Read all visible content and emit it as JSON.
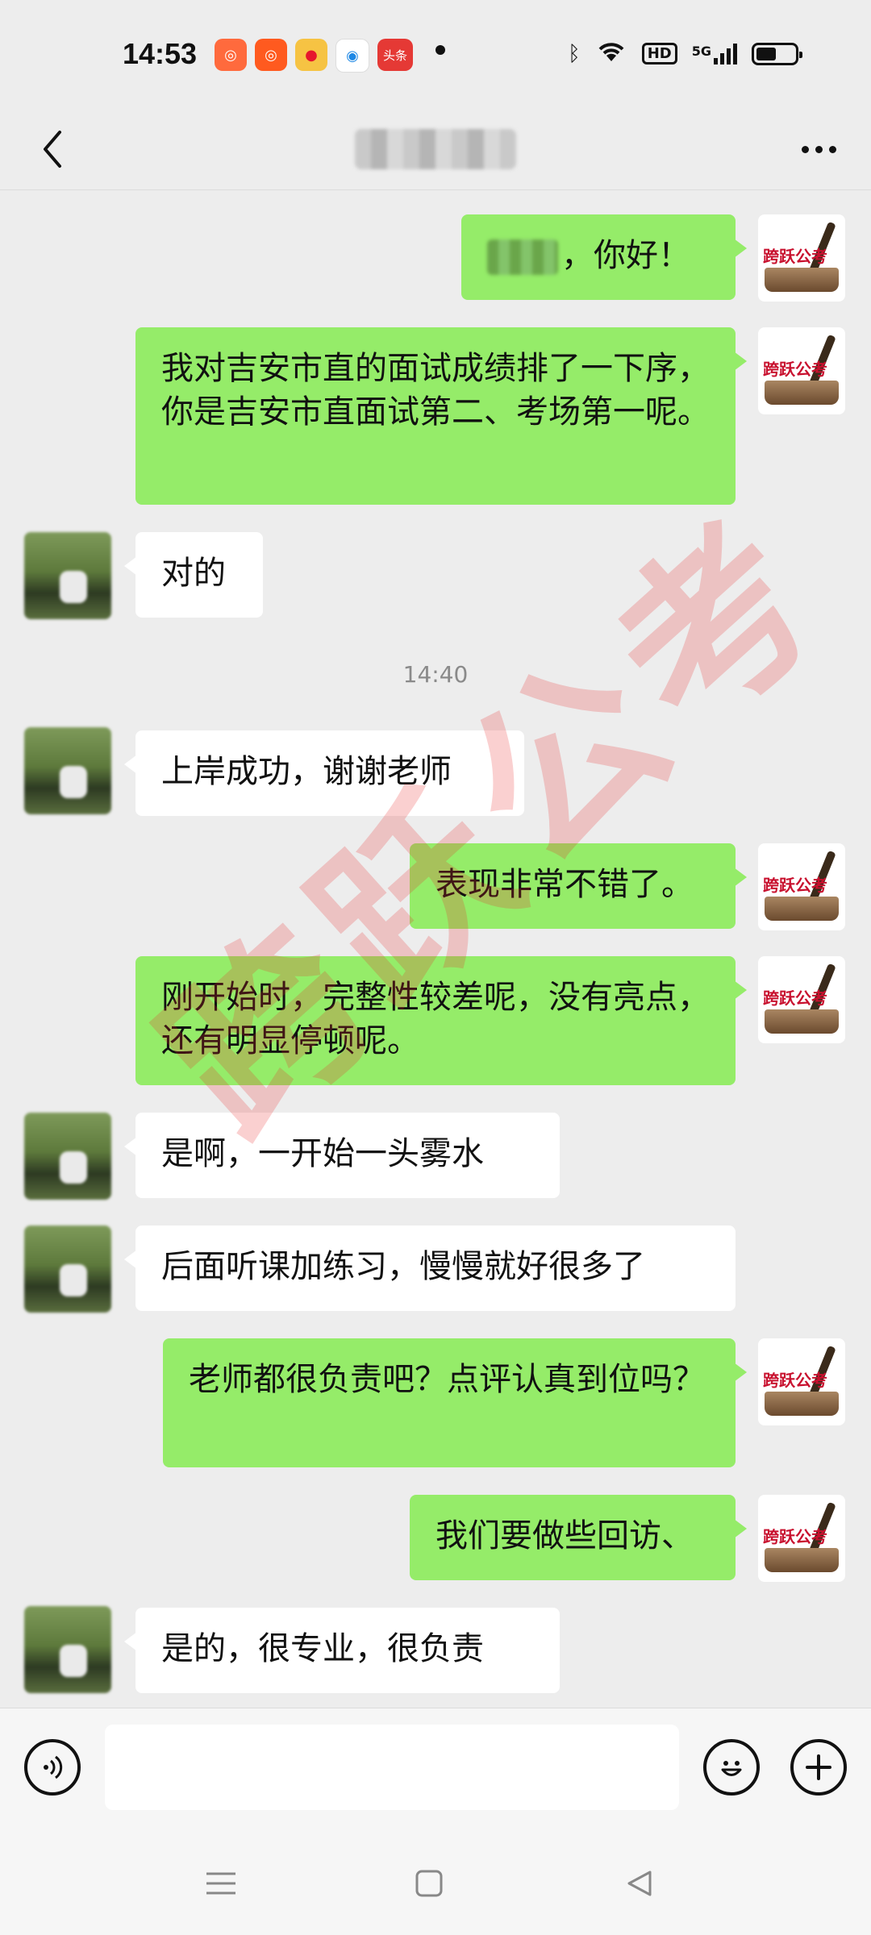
{
  "status_bar": {
    "time": "14:53",
    "notification_icons": [
      "kuaishou-icon",
      "kuaishou-icon",
      "weibo-icon",
      "browser-icon",
      "toutiao-icon"
    ],
    "toutiao_label": "头条",
    "hd_label": "HD",
    "network_label": "5G"
  },
  "header": {
    "back_icon": "chevron-left-icon",
    "title": "",
    "more_icon": "more-dots-icon"
  },
  "chat": {
    "messages": [
      {
        "side": "me",
        "text": "，你好！",
        "has_blurred_name": true
      },
      {
        "side": "me",
        "text": "我对吉安市直的面试成绩排了一下序，你是吉安市直面试第二、考场第一呢。"
      },
      {
        "side": "other",
        "text": "对的"
      },
      {
        "side": "me",
        "text": "表现非常不错了。"
      },
      {
        "side": "other",
        "text": "上岸成功，谢谢老师"
      },
      {
        "side": "me",
        "text": "刚开始时，完整性较差呢，没有亮点，还有明显停顿呢。"
      },
      {
        "side": "other",
        "text": "是啊，一开始一头雾水"
      },
      {
        "side": "other",
        "text": "后面听课加练习，慢慢就好很多了"
      },
      {
        "side": "me",
        "text": "老师都很负责吧？点评认真到位吗？"
      },
      {
        "side": "me",
        "text": "我们要做些回访、"
      },
      {
        "side": "other",
        "text": "是的，很专业，很负责"
      }
    ],
    "timestamp": "14:40",
    "avatar_brand_text": "跨跃公考",
    "watermark_text": "跨跃公考"
  },
  "input_bar": {
    "voice_icon": "voice-icon",
    "emoji_icon": "emoji-icon",
    "plus_icon": "plus-icon",
    "input_value": ""
  },
  "nav_bar": {
    "menu_icon": "menu-icon",
    "home_icon": "home-icon",
    "back_icon": "back-triangle-icon"
  },
  "colors": {
    "background": "#ededed",
    "bubble_me": "#95ec69",
    "bubble_other": "#ffffff",
    "watermark": "#e62828"
  }
}
